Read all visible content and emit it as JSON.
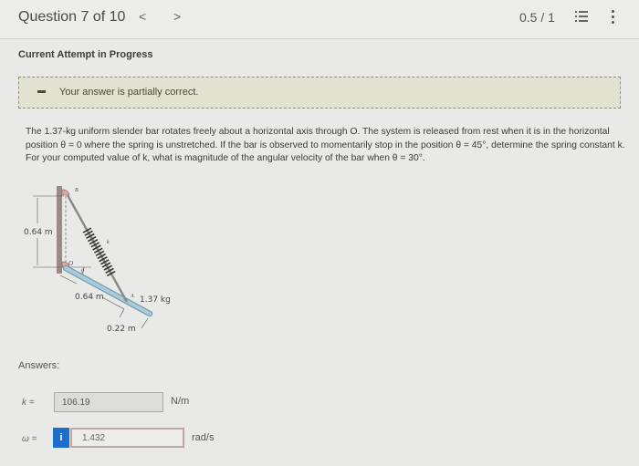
{
  "header": {
    "title": "Question 7 of 10",
    "prev_glyph": "<",
    "next_glyph": ">",
    "score": "0.5 / 1",
    "list_icon": "list-icon",
    "more_icon": "more-vertical-icon"
  },
  "attempt_status": "Current Attempt in Progress",
  "feedback": {
    "message": "Your answer is partially correct.",
    "icon": "minus-icon",
    "background": "#e1e2cf"
  },
  "question": {
    "text": "The 1.37-kg uniform slender bar rotates freely about a horizontal axis through O. The system is released from rest when it is in the horizontal position θ = 0 where the spring is unstretched. If the bar is observed to momentarily stop in the position θ = 45°, determine the spring constant k. For your computed value of k, what is magnitude of the angular velocity of the bar when θ = 30°."
  },
  "figure": {
    "label_B": "B",
    "label_O": "O",
    "label_A": "A",
    "label_k": "k",
    "label_theta": "θ",
    "dim_vertical": "0.64 m",
    "dim_OA": "0.64 m",
    "dim_A_end": "0.22 m",
    "mass": "1.37 kg"
  },
  "answers": {
    "label": "Answers:",
    "k": {
      "label": "k =",
      "value": "106.19",
      "unit": "N/m"
    },
    "omega": {
      "label": "ω =",
      "value": "1.432",
      "unit": "rad/s",
      "info_glyph": "i"
    }
  },
  "colors": {
    "accent_blue": "#1b6fc8",
    "bar_blue": "#9fc3d6"
  }
}
